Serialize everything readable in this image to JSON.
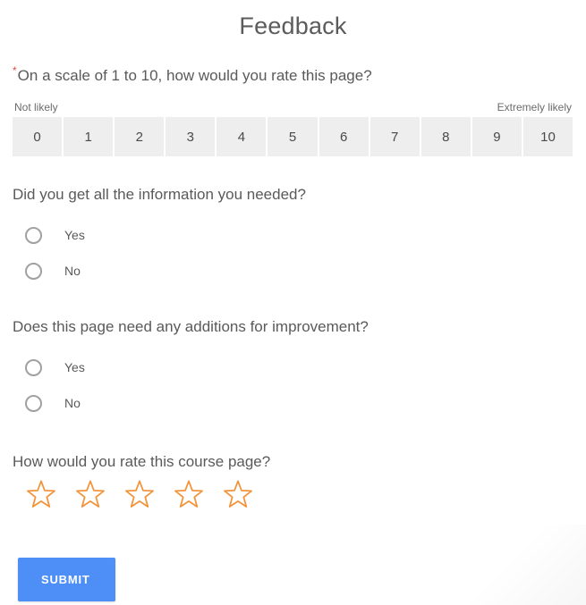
{
  "form": {
    "title": "Feedback",
    "required_marker": "*"
  },
  "nps": {
    "question": "On a scale of 1 to 10, how would you rate this page?",
    "required": true,
    "low_anchor": "Not likely",
    "high_anchor": "Extremely likely",
    "options": [
      "0",
      "1",
      "2",
      "3",
      "4",
      "5",
      "6",
      "7",
      "8",
      "9",
      "10"
    ],
    "selected": null
  },
  "questions": [
    {
      "label": "Did you get all the information you needed?",
      "options": [
        {
          "label": "Yes",
          "selected": false
        },
        {
          "label": "No",
          "selected": false
        }
      ]
    },
    {
      "label": "Does this page need any additions for improvement?",
      "options": [
        {
          "label": "Yes",
          "selected": false
        },
        {
          "label": "No",
          "selected": false
        }
      ]
    }
  ],
  "star_rating": {
    "label": "How would you rate this course page?",
    "max": 5,
    "value": 0,
    "star_color": "#f29339"
  },
  "submit": {
    "label": "SUBMIT",
    "color": "#4d8ef7"
  },
  "colors": {
    "title_text": "#5b5b5b",
    "question_text": "#5a5a5a",
    "anchor_text": "#6b6b6b",
    "scale_cell_bg": "#eeeeee",
    "radio_border": "#a0a0a0",
    "required_red": "#e04a3f"
  }
}
